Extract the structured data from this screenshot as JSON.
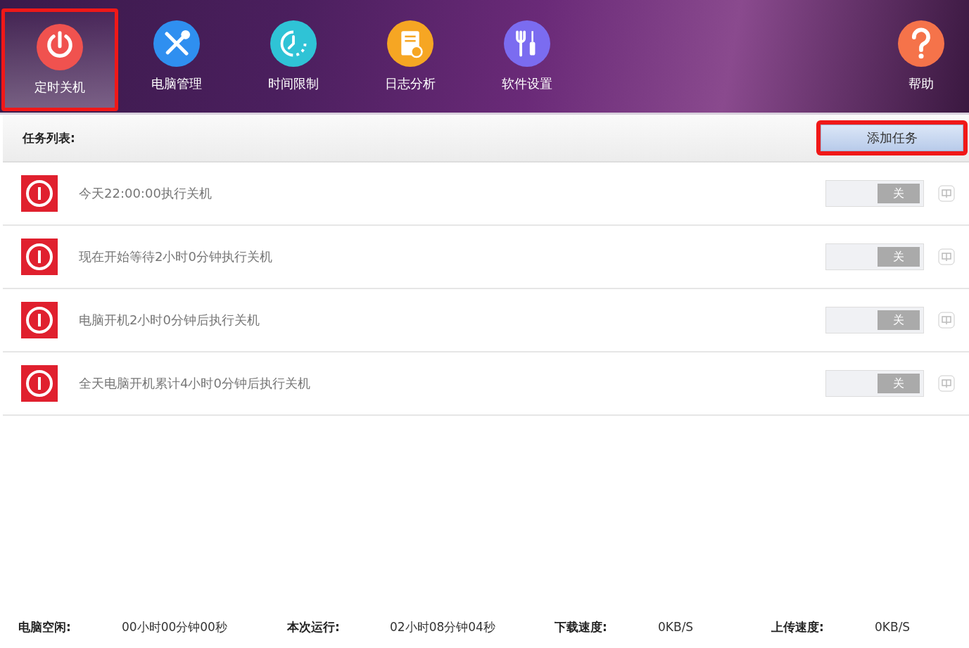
{
  "nav": {
    "items": [
      {
        "label": "定时关机",
        "kind": "power",
        "selected": true,
        "highlighted": true
      },
      {
        "label": "电脑管理",
        "kind": "tools",
        "selected": false,
        "highlighted": false
      },
      {
        "label": "时间限制",
        "kind": "timer",
        "selected": false,
        "highlighted": false
      },
      {
        "label": "日志分析",
        "kind": "log",
        "selected": false,
        "highlighted": false
      },
      {
        "label": "软件设置",
        "kind": "settings",
        "selected": false,
        "highlighted": false
      }
    ],
    "help": {
      "label": "帮助"
    }
  },
  "task_list": {
    "title": "任务列表:",
    "add_button": {
      "label": "添加任务",
      "highlighted": true
    },
    "tasks": [
      {
        "text": "今天22:00:00执行关机",
        "switch_label": "关",
        "on": false
      },
      {
        "text": "现在开始等待2小时0分钟执行关机",
        "switch_label": "关",
        "on": false
      },
      {
        "text": "电脑开机2小时0分钟后执行关机",
        "switch_label": "关",
        "on": false
      },
      {
        "text": "全天电脑开机累计4小时0分钟后执行关机",
        "switch_label": "关",
        "on": false
      }
    ]
  },
  "status_bar": [
    {
      "label": "电脑空闲:",
      "value": "00小时00分钟00秒"
    },
    {
      "label": "本次运行:",
      "value": "02小时08分钟04秒"
    },
    {
      "label": "下载速度:",
      "value": "0KB/S"
    },
    {
      "label": "上传速度:",
      "value": "0KB/S"
    }
  ]
}
